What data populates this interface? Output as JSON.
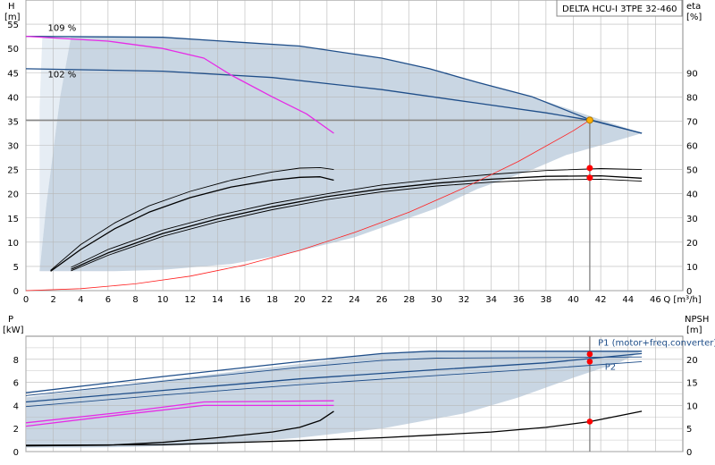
{
  "title": "DELTA HCU-I 3TPE 32-460",
  "colors": {
    "envelope": "#c9d6e3",
    "envelope_light": "#e6edf4",
    "curve_blue": "#1f4e89",
    "curve_magenta": "#e62be6",
    "curve_black": "#000000",
    "system_red": "#ff2020",
    "op_point": "#ff0000",
    "duty_point": "#ffb000",
    "grid": "#b8b8b8"
  },
  "chart_data": [
    {
      "type": "line",
      "name": "head-curve",
      "ylabel": "H",
      "yunit": "[m]",
      "y2label": "eta",
      "y2unit": "[%]",
      "xlabel": "Q [m³/h]",
      "xlim": [
        0,
        48
      ],
      "ylim": [
        0,
        60
      ],
      "y2lim": [
        0,
        120
      ],
      "x_ticks": [
        0,
        2,
        4,
        6,
        8,
        10,
        12,
        14,
        16,
        18,
        20,
        22,
        24,
        26,
        28,
        30,
        32,
        34,
        36,
        38,
        40,
        42,
        44,
        46
      ],
      "y_ticks": [
        0,
        5,
        10,
        15,
        20,
        25,
        30,
        35,
        40,
        45,
        50,
        55
      ],
      "y2_ticks": [
        0,
        10,
        20,
        30,
        40,
        50,
        60,
        70,
        80,
        90
      ],
      "grid": true,
      "annotations": [
        {
          "text": "109 %",
          "x": 1.6,
          "y": 53.6
        },
        {
          "text": "102 %",
          "x": 1.6,
          "y": 44.0
        }
      ],
      "envelope": [
        [
          1.0,
          4.0
        ],
        [
          1.5,
          18
        ],
        [
          2.5,
          40
        ],
        [
          3.3,
          52.5
        ],
        [
          10,
          52.3
        ],
        [
          20,
          50.5
        ],
        [
          26,
          48
        ],
        [
          29.5,
          45.8
        ],
        [
          37,
          40
        ],
        [
          45,
          32.5
        ],
        [
          42,
          30
        ],
        [
          39.5,
          28
        ],
        [
          37,
          25
        ],
        [
          33,
          21
        ],
        [
          30,
          17
        ],
        [
          24,
          11
        ],
        [
          19,
          7.5
        ],
        [
          15,
          5.5
        ],
        [
          10,
          4.3
        ],
        [
          6.5,
          4.0
        ],
        [
          3.3,
          4.0
        ]
      ],
      "envelope_light": [
        [
          1.0,
          4.0
        ],
        [
          1.0,
          38
        ],
        [
          1.2,
          52.5
        ],
        [
          3.3,
          52.5
        ],
        [
          2.5,
          40
        ],
        [
          1.5,
          18
        ]
      ],
      "series": [
        {
          "role": "head-max",
          "color": "curve_blue",
          "width": 1.3,
          "points": [
            [
              0,
              52.5
            ],
            [
              10,
              52.3
            ],
            [
              20,
              50.5
            ],
            [
              26,
              48
            ],
            [
              29.5,
              45.8
            ],
            [
              33,
              43
            ],
            [
              37,
              40
            ],
            [
              41.2,
              35.3
            ],
            [
              45,
              32.5
            ]
          ]
        },
        {
          "role": "head-102",
          "color": "curve_blue",
          "width": 1.3,
          "points": [
            [
              0,
              45.8
            ],
            [
              10,
              45.3
            ],
            [
              18,
              44
            ],
            [
              26,
              41.5
            ],
            [
              33,
              38.7
            ],
            [
              38,
              36.7
            ],
            [
              41.2,
              35.2
            ],
            [
              45,
              32.5
            ]
          ]
        },
        {
          "role": "head-109-limit",
          "color": "curve_magenta",
          "width": 1.3,
          "points": [
            [
              0,
              52.5
            ],
            [
              6,
              51.5
            ],
            [
              10,
              50
            ],
            [
              13,
              48
            ],
            [
              15,
              44.5
            ],
            [
              18,
              40
            ],
            [
              20.5,
              36.5
            ],
            [
              22.5,
              32.5
            ]
          ]
        },
        {
          "role": "eta-short-1",
          "color": "curve_black",
          "width": 0.9,
          "points": [
            [
              1.8,
              4.2
            ],
            [
              4,
              9.5
            ],
            [
              6.5,
              14
            ],
            [
              9,
              17.5
            ],
            [
              12,
              20.5
            ],
            [
              15,
              22.8
            ],
            [
              18,
              24.5
            ],
            [
              20,
              25.3
            ],
            [
              21.5,
              25.4
            ],
            [
              22.5,
              25
            ]
          ]
        },
        {
          "role": "eta-short-2",
          "color": "curve_black",
          "width": 1.3,
          "points": [
            [
              1.8,
              4.0
            ],
            [
              4,
              8.5
            ],
            [
              6.5,
              12.8
            ],
            [
              9,
              16.2
            ],
            [
              12,
              19.2
            ],
            [
              15,
              21.4
            ],
            [
              18,
              22.8
            ],
            [
              20,
              23.4
            ],
            [
              21.5,
              23.5
            ],
            [
              22.5,
              22.8
            ]
          ]
        },
        {
          "role": "eta-long-1",
          "color": "curve_black",
          "width": 0.9,
          "points": [
            [
              3.3,
              4.8
            ],
            [
              6,
              8.5
            ],
            [
              10,
              12.5
            ],
            [
              14,
              15.5
            ],
            [
              18,
              18
            ],
            [
              22,
              20
            ],
            [
              26,
              21.8
            ],
            [
              30,
              23
            ],
            [
              34,
              24
            ],
            [
              38,
              24.8
            ],
            [
              42,
              25.2
            ],
            [
              45,
              25
            ]
          ]
        },
        {
          "role": "eta-long-2",
          "color": "curve_black",
          "width": 1.3,
          "points": [
            [
              3.3,
              4.4
            ],
            [
              6,
              7.8
            ],
            [
              10,
              11.8
            ],
            [
              14,
              14.8
            ],
            [
              18,
              17.3
            ],
            [
              22,
              19.4
            ],
            [
              26,
              21
            ],
            [
              30,
              22.2
            ],
            [
              34,
              23
            ],
            [
              38,
              23.6
            ],
            [
              42,
              23.7
            ],
            [
              45,
              23.2
            ]
          ]
        },
        {
          "role": "eta-long-3",
          "color": "curve_black",
          "width": 0.9,
          "points": [
            [
              3.3,
              4.1
            ],
            [
              6,
              7.3
            ],
            [
              10,
              11.2
            ],
            [
              14,
              14.2
            ],
            [
              18,
              16.7
            ],
            [
              22,
              18.8
            ],
            [
              26,
              20.4
            ],
            [
              30,
              21.6
            ],
            [
              34,
              22.4
            ],
            [
              38,
              22.9
            ],
            [
              42,
              23
            ],
            [
              45,
              22.6
            ]
          ]
        },
        {
          "role": "system-curve",
          "color": "system_red",
          "width": 0.8,
          "points": [
            [
              0,
              0
            ],
            [
              4,
              0.4
            ],
            [
              8,
              1.4
            ],
            [
              12,
              3
            ],
            [
              16,
              5.3
            ],
            [
              20,
              8.3
            ],
            [
              24,
              12
            ],
            [
              28,
              16.2
            ],
            [
              32,
              21.2
            ],
            [
              36,
              26.7
            ],
            [
              40,
              33
            ],
            [
              41.2,
              35.2
            ]
          ]
        }
      ],
      "operating_lines": [
        {
          "role": "horizontal",
          "points": [
            [
              0,
              35.2
            ],
            [
              41.2,
              35.2
            ]
          ]
        },
        {
          "role": "vertical",
          "points": [
            [
              41.2,
              35.2
            ],
            [
              41.2,
              0
            ]
          ]
        }
      ],
      "markers": [
        {
          "role": "duty-point",
          "x": 41.2,
          "y": 35.2,
          "color": "duty_point"
        },
        {
          "role": "eta-point-1",
          "x": 41.2,
          "y": 25.3,
          "color": "op_point"
        },
        {
          "role": "eta-point-2",
          "x": 41.2,
          "y": 23.3,
          "color": "op_point"
        }
      ]
    },
    {
      "type": "line",
      "name": "power-curve",
      "ylabel": "P",
      "yunit": "[kW]",
      "y2label": "NPSH",
      "y2unit": "[m]",
      "xlim": [
        0,
        48
      ],
      "ylim": [
        0,
        10
      ],
      "y2lim": [
        0,
        25
      ],
      "y_ticks": [
        0,
        2,
        4,
        6,
        8
      ],
      "y2_ticks": [
        0,
        5,
        10,
        15,
        20
      ],
      "grid": true,
      "annotations": [
        {
          "text": "P1 (motor+freq.converter)",
          "x": 41.8,
          "y": 9.2
        },
        {
          "text": "P2",
          "x": 42.3,
          "y": 7.1
        }
      ],
      "envelope": [
        [
          0,
          4.7
        ],
        [
          10,
          6.2
        ],
        [
          20,
          7.6
        ],
        [
          26,
          8.5
        ],
        [
          29.5,
          8.7
        ],
        [
          45,
          8.7
        ],
        [
          43.5,
          7.8
        ],
        [
          40,
          6.4
        ],
        [
          36,
          4.7
        ],
        [
          32,
          3.3
        ],
        [
          26,
          2.0
        ],
        [
          20,
          1.2
        ],
        [
          14,
          0.65
        ],
        [
          8,
          0.4
        ],
        [
          4,
          0.35
        ],
        [
          0,
          0.35
        ]
      ],
      "series": [
        {
          "role": "P1-max",
          "color": "curve_blue",
          "width": 1.3,
          "points": [
            [
              0,
              5.1
            ],
            [
              10,
              6.5
            ],
            [
              20,
              7.8
            ],
            [
              26,
              8.5
            ],
            [
              29.5,
              8.7
            ],
            [
              45,
              8.7
            ]
          ]
        },
        {
          "role": "P2-max",
          "color": "curve_blue",
          "width": 0.9,
          "points": [
            [
              0,
              4.85
            ],
            [
              10,
              6.1
            ],
            [
              20,
              7.3
            ],
            [
              26,
              7.9
            ],
            [
              30,
              8.1
            ],
            [
              45,
              8.2
            ]
          ]
        },
        {
          "role": "P1-102",
          "color": "curve_blue",
          "width": 1.3,
          "points": [
            [
              0,
              4.3
            ],
            [
              10,
              5.3
            ],
            [
              20,
              6.3
            ],
            [
              30,
              7.1
            ],
            [
              38,
              7.7
            ],
            [
              45,
              8.5
            ]
          ]
        },
        {
          "role": "P2-102",
          "color": "curve_blue",
          "width": 0.9,
          "points": [
            [
              0,
              3.9
            ],
            [
              10,
              4.9
            ],
            [
              20,
              5.8
            ],
            [
              30,
              6.6
            ],
            [
              38,
              7.2
            ],
            [
              45,
              7.8
            ]
          ]
        },
        {
          "role": "P-109-1",
          "color": "curve_magenta",
          "width": 1.3,
          "points": [
            [
              0,
              2.5
            ],
            [
              7,
              3.4
            ],
            [
              13,
              4.3
            ],
            [
              22.5,
              4.4
            ]
          ]
        },
        {
          "role": "P-109-2",
          "color": "curve_magenta",
          "width": 1.3,
          "points": [
            [
              0,
              2.2
            ],
            [
              7,
              3.2
            ],
            [
              13,
              4.0
            ],
            [
              22.5,
              4.0
            ]
          ]
        },
        {
          "role": "NPSH-short",
          "color": "curve_black",
          "width": 1.3,
          "points": [
            [
              0,
              0.5
            ],
            [
              6,
              0.55
            ],
            [
              10,
              0.8
            ],
            [
              14,
              1.2
            ],
            [
              18,
              1.7
            ],
            [
              20,
              2.1
            ],
            [
              21.5,
              2.7
            ],
            [
              22.5,
              3.5
            ]
          ]
        },
        {
          "role": "NPSH-long",
          "color": "curve_black",
          "width": 1.3,
          "points": [
            [
              0,
              0.55
            ],
            [
              10,
              0.6
            ],
            [
              20,
              0.95
            ],
            [
              26,
              1.2
            ],
            [
              30,
              1.45
            ],
            [
              34,
              1.7
            ],
            [
              38,
              2.1
            ],
            [
              41.2,
              2.6
            ],
            [
              45,
              3.5
            ]
          ]
        }
      ],
      "operating_lines": [
        {
          "role": "vertical",
          "points": [
            [
              41.2,
              10
            ],
            [
              41.2,
              0
            ]
          ]
        }
      ],
      "markers": [
        {
          "role": "P1-point",
          "x": 41.2,
          "y": 8.45,
          "color": "op_point"
        },
        {
          "role": "P2-point",
          "x": 41.2,
          "y": 7.8,
          "color": "op_point"
        },
        {
          "role": "NPSH-point",
          "x": 41.2,
          "y": 2.6,
          "color": "op_point"
        }
      ]
    }
  ]
}
